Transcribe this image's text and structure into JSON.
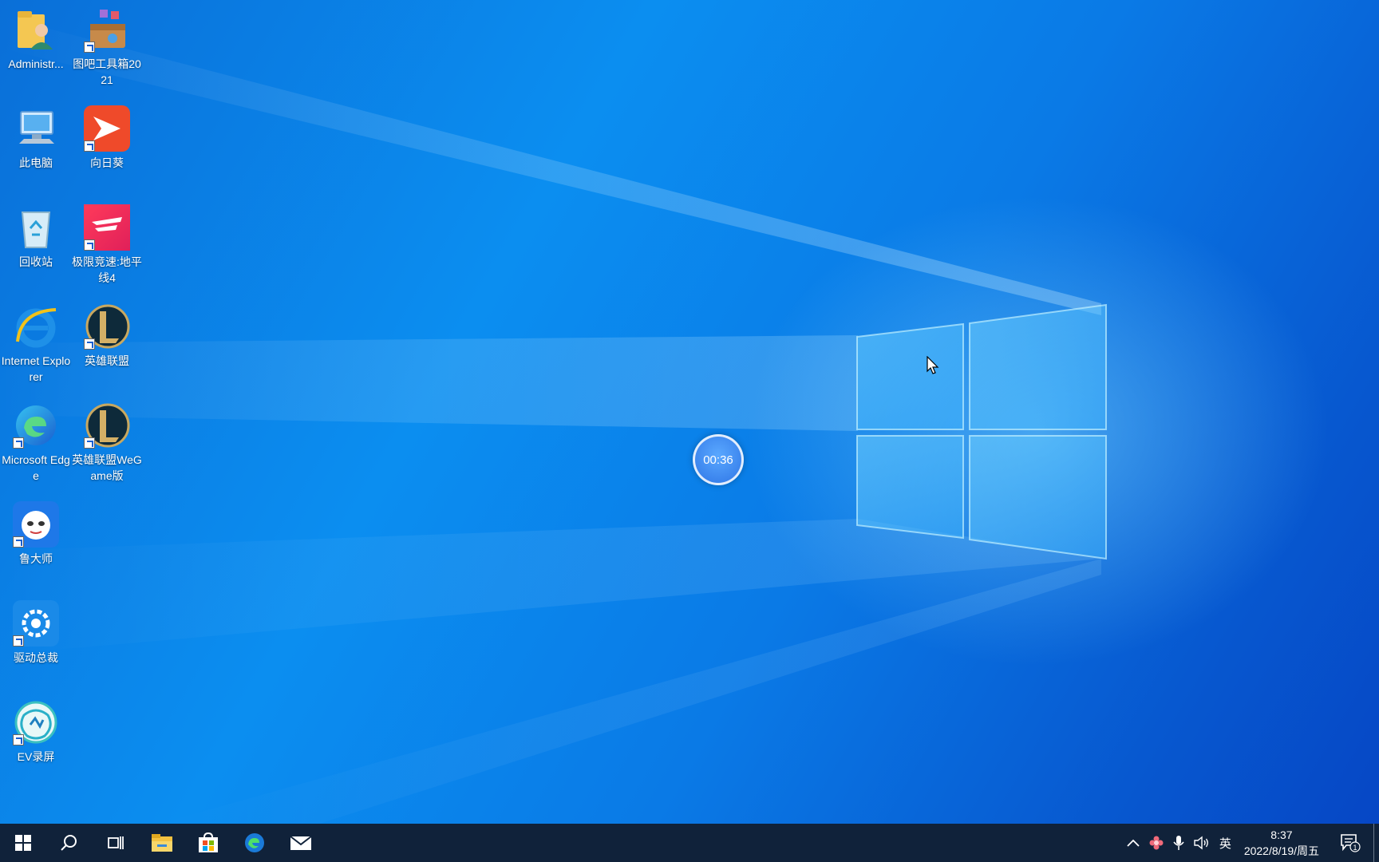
{
  "desktop": {
    "icons": [
      {
        "label": "Administr...",
        "icon": "user-folder-icon"
      },
      {
        "label": "图吧工具箱2021",
        "icon": "toolbox-icon"
      },
      {
        "label": "此电脑",
        "icon": "computer-icon"
      },
      {
        "label": "向日葵",
        "icon": "sunflower-remote-icon"
      },
      {
        "label": "回收站",
        "icon": "recycle-bin-icon"
      },
      {
        "label": "极限竞速:地平线4",
        "icon": "forza-horizon-icon"
      },
      {
        "label": "Internet Explorer",
        "icon": "internet-explorer-icon"
      },
      {
        "label": "英雄联盟",
        "icon": "league-of-legends-icon"
      },
      {
        "label": "Microsoft Edge",
        "icon": "edge-icon"
      },
      {
        "label": "英雄联盟WeGame版",
        "icon": "league-of-legends-icon"
      },
      {
        "label": "鲁大师",
        "icon": "ludashi-icon"
      },
      {
        "label": "驱动总裁",
        "icon": "driver-tool-icon"
      },
      {
        "label": "EV录屏",
        "icon": "ev-recorder-icon"
      }
    ]
  },
  "timer": {
    "text": "00:36"
  },
  "taskbar": {
    "items": [
      "start-icon",
      "search-icon",
      "task-view-icon",
      "file-explorer-icon",
      "store-icon",
      "edge-icon",
      "mail-icon"
    ],
    "tray": {
      "ime": "英",
      "time": "8:37",
      "date": "2022/8/19/周五",
      "notifications": "1"
    }
  },
  "colors": {
    "taskbar": "#10223a",
    "accent": "#0a8ef0"
  }
}
